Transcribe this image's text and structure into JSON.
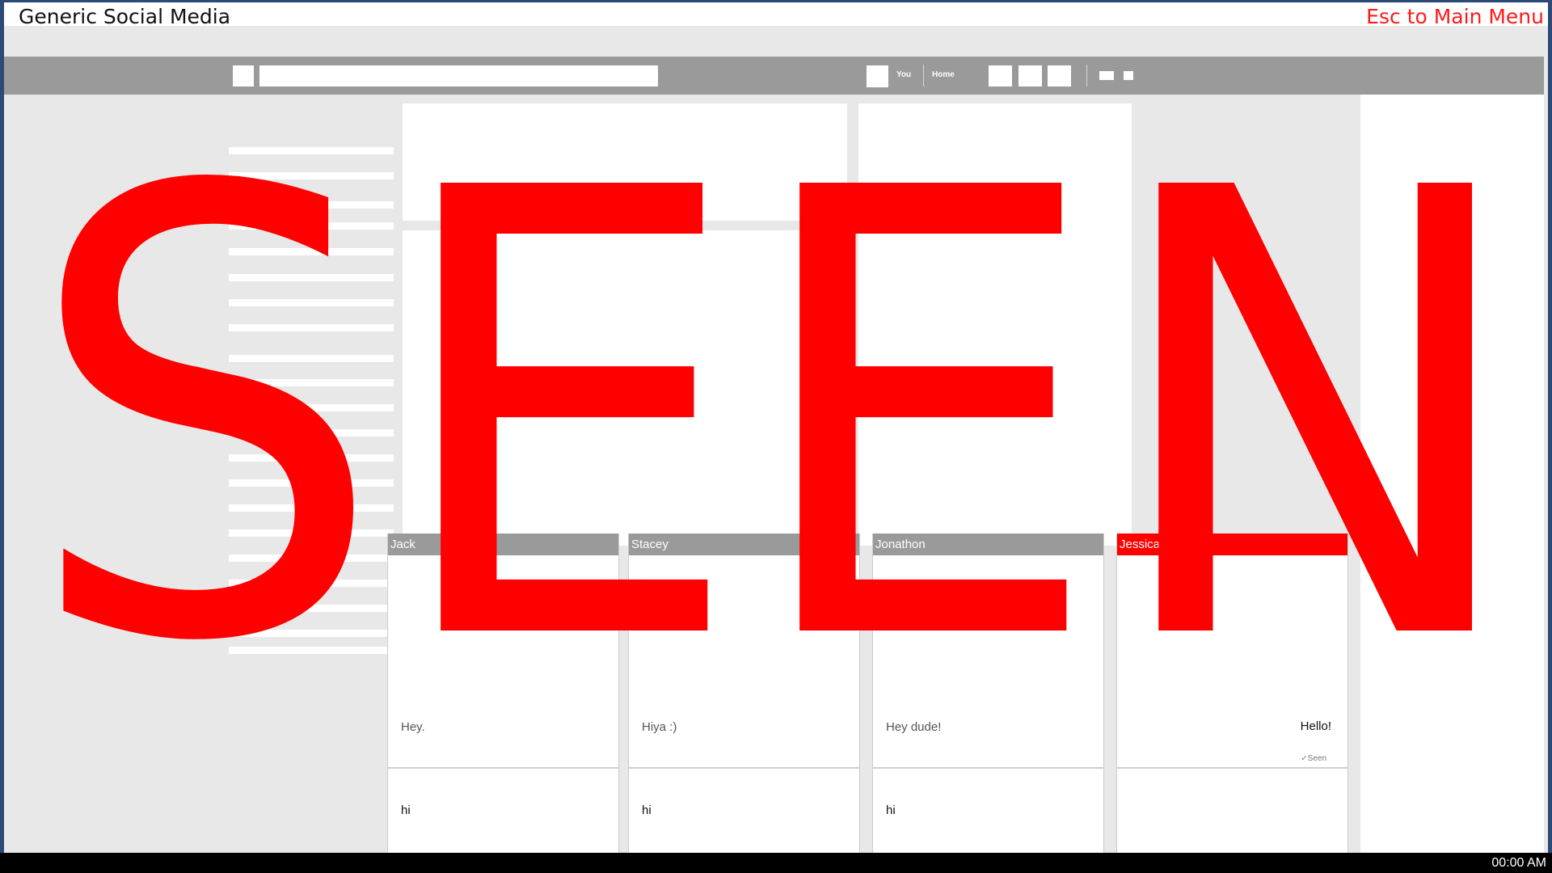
{
  "window": {
    "title": "Generic Social Media",
    "esc_label": "Esc to Main Menu"
  },
  "nav": {
    "you_label": "You",
    "home_label": "Home"
  },
  "overlay": {
    "text": "SEEN",
    "color": "#ff0000"
  },
  "chats": [
    {
      "name": "Jack",
      "message": "Hey.",
      "input": "hi"
    },
    {
      "name": "Stacey",
      "message": "Hiya :)",
      "input": "hi"
    },
    {
      "name": "Jonathon",
      "message": "Hey dude!",
      "input": "hi"
    },
    {
      "name": "Jessica",
      "message": "Hello!",
      "status": "✓Seen",
      "input": ""
    }
  ],
  "statusbar": {
    "clock": "00:00 AM"
  },
  "colors": {
    "accent": "#ff0000",
    "nav_bg": "#9a9a9a",
    "page_bg": "#e8e8e8"
  }
}
